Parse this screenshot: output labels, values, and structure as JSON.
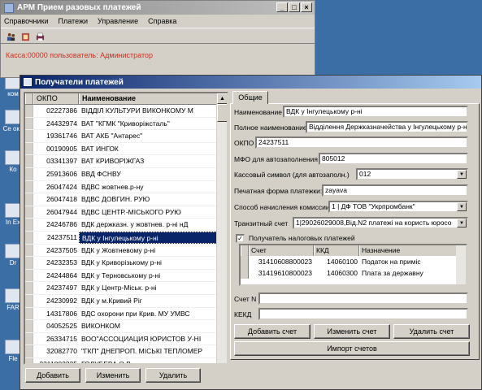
{
  "main_window": {
    "title": "АРМ Прием разовых платежей",
    "menu": [
      "Справочники",
      "Платежи",
      "Управление",
      "Справка"
    ],
    "toolbar_icons": [
      "users-icon",
      "settings-icon",
      "print-icon"
    ],
    "status": "Касса:00000 пользователь: Администратор",
    "controls": {
      "minimize": "_",
      "maximize": "□",
      "close": "×"
    }
  },
  "desktop_icons": [
    "ком",
    "Се окр",
    "Ко",
    "In Ex",
    "Dr",
    "FAR",
    "Fle"
  ],
  "payee_window": {
    "title": "Получатели платежей",
    "list": {
      "columns": [
        "ОКПО",
        "Наименование"
      ],
      "rows": [
        {
          "okpo": "02227386",
          "name": "ВІДДІЛ КУЛЬТУРИ ВИКОНКОМУ М"
        },
        {
          "okpo": "24432974",
          "name": "ВАТ \"КГМК \"Криворіжсталь\""
        },
        {
          "okpo": "19361746",
          "name": "ВАТ АКБ \"Антарес\""
        },
        {
          "okpo": "00190905",
          "name": "ВАТ ИНГОК"
        },
        {
          "okpo": "03341397",
          "name": "ВАТ КРИВОРІЖГАЗ"
        },
        {
          "okpo": "25913606",
          "name": "ВВД ФСНВУ"
        },
        {
          "okpo": "26047424",
          "name": "ВДВС жовтнев.р-ну"
        },
        {
          "okpo": "26047418",
          "name": "ВДВС ДОВГИН. РУЮ"
        },
        {
          "okpo": "26047944",
          "name": "ВДВС ЦЕНТР.-МІСЬКОГО РУЮ"
        },
        {
          "okpo": "24246786",
          "name": "ВДК держказн. у жовтнев. р-ні нД"
        },
        {
          "okpo": "24237511",
          "name": "ВДК у Інгулецькому р-ні",
          "selected": true
        },
        {
          "okpo": "24237505",
          "name": "ВДК у Жовтневому р-ні"
        },
        {
          "okpo": "24232353",
          "name": "ВДК у Криворізькому р-ні"
        },
        {
          "okpo": "24244864",
          "name": "ВДК у Терновському р-ні"
        },
        {
          "okpo": "24237497",
          "name": "ВДК у Центр-Міськ. р-ні"
        },
        {
          "okpo": "24230992",
          "name": "ВДК у м.Кривий Ріг"
        },
        {
          "okpo": "14317806",
          "name": "ВДС охорони при Крив. МУ УМВС"
        },
        {
          "okpo": "04052525",
          "name": "ВИКОНКОМ"
        },
        {
          "okpo": "26334715",
          "name": "ВОО\"АССОЦИАЦИЯ ЮРИСТОВ У-НІ"
        },
        {
          "okpo": "32082770",
          "name": "\"ГКП\" ДНЕПРОП. МІСЬКІ ТЕПЛОМЕР"
        },
        {
          "okpo": "2311803225",
          "name": "ГОЛУБЕВА О.В."
        }
      ]
    },
    "buttons": {
      "add": "Добавить",
      "edit": "Изменить",
      "delete": "Удалить"
    },
    "tab": "Общие",
    "form": {
      "short_name_label": "Наименование",
      "short_name": "ВДК у Інгулецькому р-ні",
      "full_name_label": "Полное наименование",
      "full_name": "Відділення Держказначейства у Інгулецькому р-ні",
      "okpo_label": "ОКПО",
      "okpo": "24237511",
      "mfo_label": "МФО для автозаполнения",
      "mfo": "805012",
      "cash_symbol_label": "Кассовый символ (для автозаполн.)",
      "cash_symbol": "012",
      "print_form_label": "Печатная форма платежки:",
      "print_form": "zayava",
      "commission_label": "Способ начисления комиссии",
      "commission": "1 | ДФ ТОВ \"Укрпромбанк\"",
      "transit_label": "Транзитный счет",
      "transit": "1|29026029008,Від.N2 платежі на користь юросо",
      "tax_checkbox_label": "Получатель налоговых платежей",
      "tax_checked": true
    },
    "accounts_grid": {
      "columns": [
        "Счет",
        "ККД",
        "Назначение"
      ],
      "rows": [
        {
          "account": "31410608800023",
          "kkd": "14060100",
          "purpose": "Податок на приміс"
        },
        {
          "account": "31419610800023",
          "kkd": "14060300",
          "purpose": "Плата за державну"
        }
      ]
    },
    "account_n_label": "Счет N",
    "account_n": "",
    "kekd_label": "КЕКД",
    "kekd": "",
    "account_buttons": {
      "add": "Добавить счет",
      "edit": "Изменить счет",
      "delete": "Удалить счет",
      "import": "Импорт счетов"
    }
  },
  "colors": {
    "titlebar_active": "#0a246a",
    "status_text": "#d03020",
    "desktop": "#3a6ea5",
    "selection": "#0a246a"
  }
}
